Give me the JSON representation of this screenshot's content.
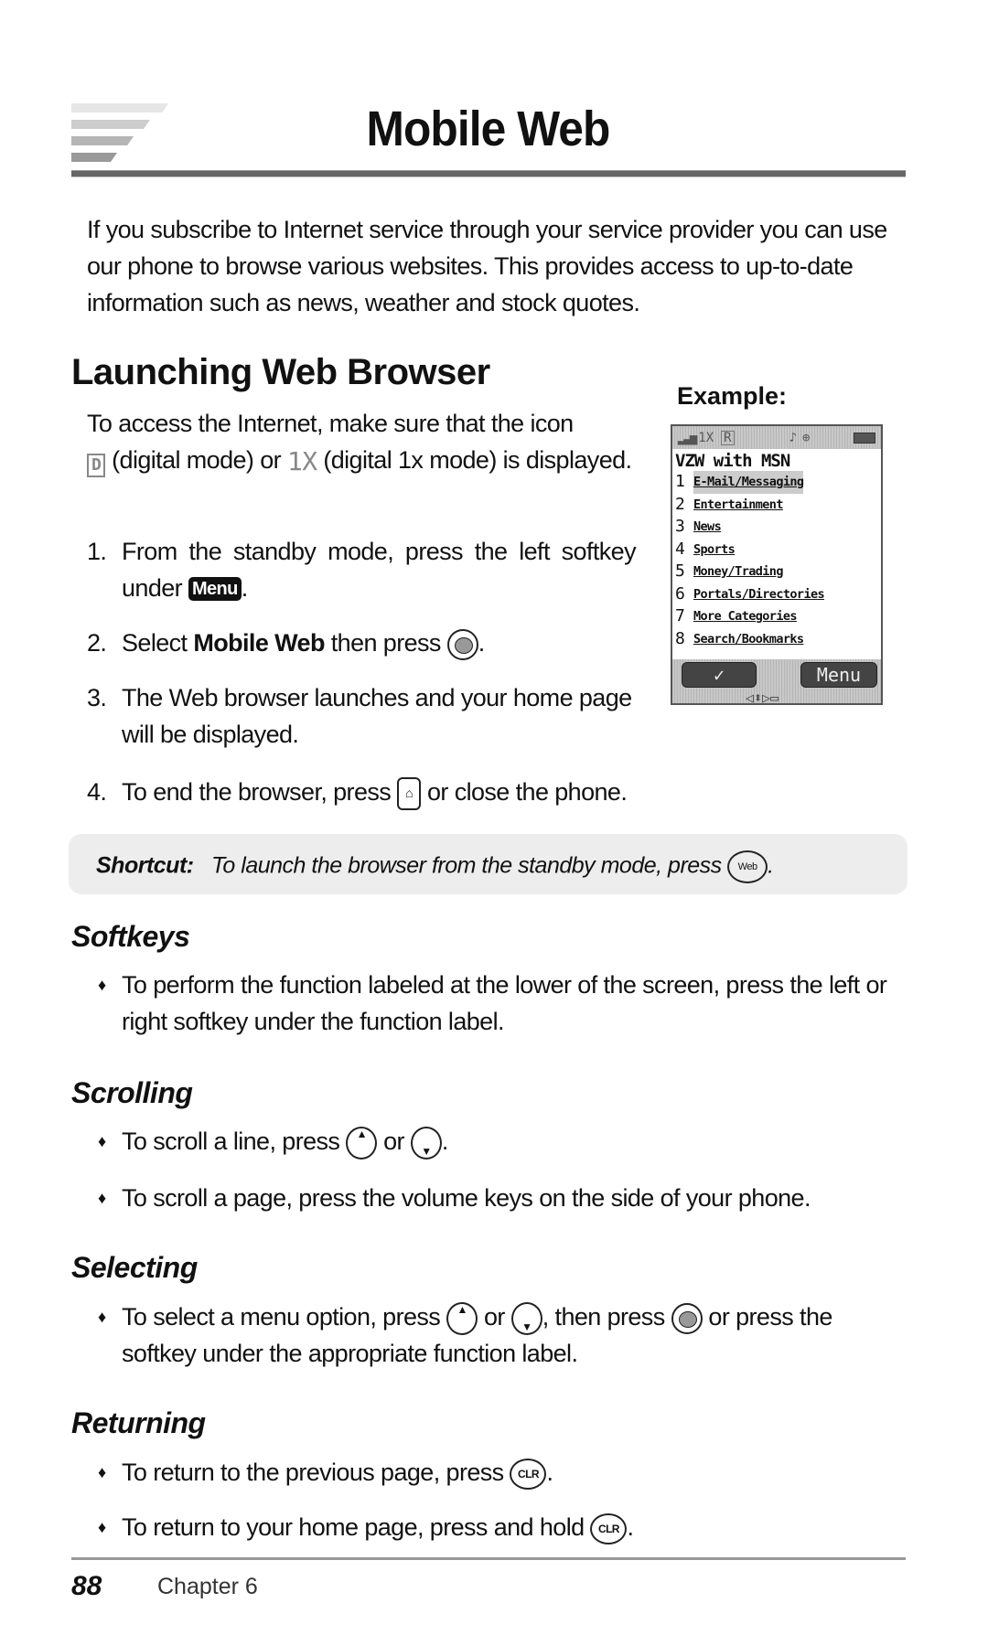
{
  "page": {
    "title": "Mobile Web",
    "intro": "If you subscribe to Internet service through your service provider you can use our phone to browse various websites. This provides access to up-to-date information such as news, weather and stock quotes."
  },
  "launching": {
    "heading": "Launching Web Browser",
    "para_part1": "To access the Internet, make sure that the icon",
    "icon_digital": "D",
    "para_part2": " (digital mode) or ",
    "icon_1x": "1X",
    "para_part3": " (digital 1x mode) is displayed.",
    "steps": [
      {
        "num": "1.",
        "text": "From the standby mode, press the left softkey under ",
        "badge": "Menu",
        "tail": "."
      },
      {
        "num": "2.",
        "pre": "Select ",
        "bold": "Mobile Web",
        "text": " then press ",
        "tail": "."
      },
      {
        "num": "3.",
        "text": "The Web browser launches and your home page will be displayed."
      },
      {
        "num": "4.",
        "text": "To end the browser, press ",
        "tail": " or close the phone."
      }
    ]
  },
  "example": {
    "label": "Example:",
    "phone": {
      "status_icons": [
        "signal-icon",
        "1x-icon",
        "roaming-icon",
        "music-icon",
        "location-icon",
        "battery-icon"
      ],
      "status_1x": "1X",
      "status_roam": "R",
      "status_music": "♪",
      "status_loc": "⊕",
      "title": "VZW with MSN",
      "items": [
        {
          "n": "1",
          "label": "E-Mail/Messaging"
        },
        {
          "n": "2",
          "label": "Entertainment"
        },
        {
          "n": "3",
          "label": "News"
        },
        {
          "n": "4",
          "label": "Sports"
        },
        {
          "n": "5",
          "label": "Money/Trading"
        },
        {
          "n": "6",
          "label": "Portals/Directories"
        },
        {
          "n": "7",
          "label": "More Categories"
        },
        {
          "n": "8",
          "label": "Search/Bookmarks"
        }
      ],
      "softkey_left": "✓",
      "softkey_right": "Menu",
      "nav_hint": "◁⬍▷▭"
    }
  },
  "shortcut": {
    "label": "Shortcut:",
    "text": "To launch the browser from the standby mode, press ",
    "key": "Web",
    "tail": "."
  },
  "sections": {
    "softkeys": {
      "heading": "Softkeys",
      "bullet1": "To perform the function labeled at the lower of the screen, press the left or right softkey under the function label."
    },
    "scrolling": {
      "heading": "Scrolling",
      "b1_pre": "To scroll a line, press ",
      "b1_or": " or ",
      "b1_tail": ".",
      "bullet2": "To scroll a page, press the volume keys on the side of your phone."
    },
    "selecting": {
      "heading": "Selecting",
      "b1_pre": "To select a menu option, press ",
      "b1_or": " or ",
      "b1_then": ", then press ",
      "b1_tail": " or press the softkey under the appropriate function label."
    },
    "returning": {
      "heading": "Returning",
      "b1_pre": "To return to the previous page, press ",
      "b2_pre": "To return to your home page, press and hold ",
      "clr": "CLR",
      "tail": "."
    }
  },
  "keys": {
    "up": "▲",
    "down": "▼",
    "end": "⌂",
    "bullet": "♦"
  },
  "footer": {
    "page_number": "88",
    "chapter": "Chapter 6"
  }
}
